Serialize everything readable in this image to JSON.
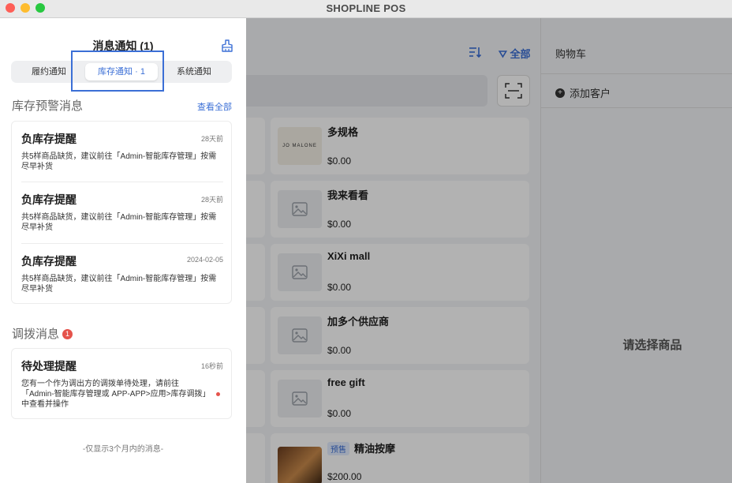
{
  "window": {
    "title": "SHOPLINE POS"
  },
  "toolbar": {
    "filter_label": "全部"
  },
  "products": [
    {
      "name": "多规格",
      "price": "$0.00",
      "thumb": "jo-malone"
    },
    {
      "name": "我来看看",
      "price": "$0.00",
      "thumb": "placeholder"
    },
    {
      "name": "XiXi mall",
      "price": "$0.00",
      "thumb": "placeholder"
    },
    {
      "name": "加多个供应商",
      "price": "$0.00",
      "thumb": "placeholder"
    },
    {
      "name": "free gift",
      "price": "$0.00",
      "thumb": "placeholder"
    },
    {
      "name": "精油按摩",
      "price": "$200.00",
      "thumb": "massage-photo",
      "badge": "预售"
    }
  ],
  "product_thumb_text": "JO MALONE",
  "cart": {
    "title": "购物车",
    "add_customer": "添加客户",
    "empty_hint": "请选择商品"
  },
  "drawer": {
    "title": "消息通知 (1)",
    "tabs": [
      {
        "label": "履约通知",
        "active": false
      },
      {
        "label": "库存通知 · 1",
        "active": true
      },
      {
        "label": "系统通知",
        "active": false
      }
    ],
    "inventory_section": {
      "heading": "库存预警消息",
      "view_all": "查看全部",
      "items": [
        {
          "title": "负库存提醒",
          "time": "28天前",
          "body": "共5样商品缺货，建议前往「Admin-智能库存管理」按需尽早补货"
        },
        {
          "title": "负库存提醒",
          "time": "28天前",
          "body": "共5样商品缺货，建议前往「Admin-智能库存管理」按需尽早补货"
        },
        {
          "title": "负库存提醒",
          "time": "2024-02-05",
          "body": "共5样商品缺货，建议前往「Admin-智能库存管理」按需尽早补货"
        }
      ]
    },
    "transfer_section": {
      "heading": "调拨消息",
      "badge": "1",
      "items": [
        {
          "title": "待处理提醒",
          "time": "16秒前",
          "body": "您有一个作为调出方的调拨单待处理，请前往「Admin-智能库存管理或 APP-APP>应用>库存调拨」中查看并操作",
          "unread": true
        }
      ]
    },
    "footer": "-仅显示3个月内的消息-"
  },
  "colors": {
    "accent": "#3b6fd6",
    "badge_red": "#e5534b"
  }
}
